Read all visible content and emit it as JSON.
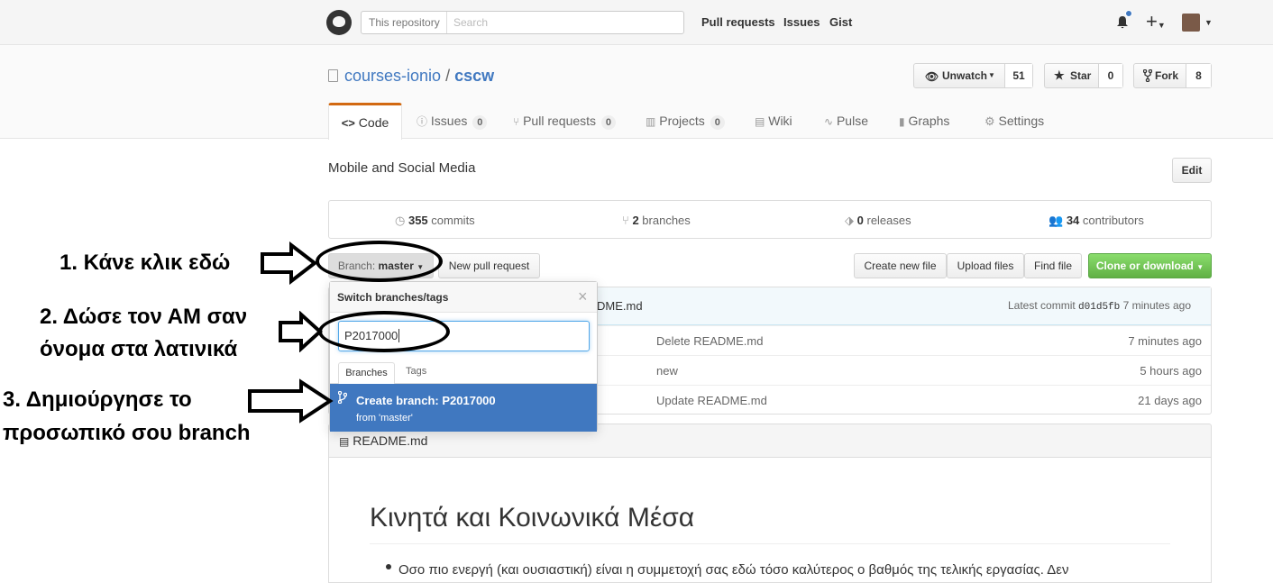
{
  "header": {
    "search_scope": "This repository",
    "search_placeholder": "Search",
    "nav": [
      "Pull requests",
      "Issues",
      "Gist"
    ]
  },
  "repo": {
    "owner": "courses-ionio",
    "separator": "/",
    "name": "cscw",
    "unwatch_label": "Unwatch",
    "unwatch_count": "51",
    "star_label": "Star",
    "star_count": "0",
    "fork_label": "Fork",
    "fork_count": "8"
  },
  "tabs": {
    "code": "Code",
    "issues": "Issues",
    "issues_count": "0",
    "pull_requests": "Pull requests",
    "pull_requests_count": "0",
    "projects": "Projects",
    "projects_count": "0",
    "wiki": "Wiki",
    "pulse": "Pulse",
    "graphs": "Graphs",
    "settings": "Settings"
  },
  "description": "Mobile and Social Media",
  "edit_label": "Edit",
  "summary": {
    "commits_num": "355",
    "commits_label": "commits",
    "branches_num": "2",
    "branches_label": "branches",
    "releases_num": "0",
    "releases_label": "releases",
    "contributors_num": "34",
    "contributors_label": "contributors"
  },
  "toolbar": {
    "branch_prefix": "Branch:",
    "branch_name": "master",
    "new_pr": "New pull request",
    "create_file": "Create new file",
    "upload_files": "Upload files",
    "find_file": "Find file",
    "clone": "Clone or download"
  },
  "commit_bar": {
    "partial_file": "DME.md",
    "latest_commit_label": "Latest commit",
    "sha": "d01d5fb",
    "time": "7 minutes ago"
  },
  "rows": [
    {
      "message": "Delete README.md",
      "age": "7 minutes ago"
    },
    {
      "message": "new",
      "age": "5 hours ago"
    },
    {
      "message": "Update README.md",
      "age": "21 days ago"
    }
  ],
  "readme": {
    "filename": "README.md",
    "heading": "Κινητά και Κοινωνικά Μέσα",
    "bullet": "Οσο πιο ενεργή (και ουσιαστική) είναι η συμμετοχή σας εδώ τόσο καλύτερος ο βαθμός της τελικής εργασίας. Δεν"
  },
  "dropdown": {
    "title": "Switch branches/tags",
    "close": "×",
    "input_value": "P2017000",
    "tab_branches": "Branches",
    "tab_tags": "Tags",
    "create_title": "Create branch: P2017000",
    "create_from": "from 'master'"
  },
  "annotations": {
    "step1": "1. Κάνε κλικ εδώ",
    "step2_line1": "2. Δώσε τον ΑΜ σαν",
    "step2_line2": "όνομα στα λατινικά",
    "step3_line1": "3. Δημιούργησε το",
    "step3_line2": "προσωπικό σου branch"
  },
  "colors": {
    "accent": "#4078c0",
    "tab_active": "#d26911",
    "clone_green": "#60b044"
  }
}
